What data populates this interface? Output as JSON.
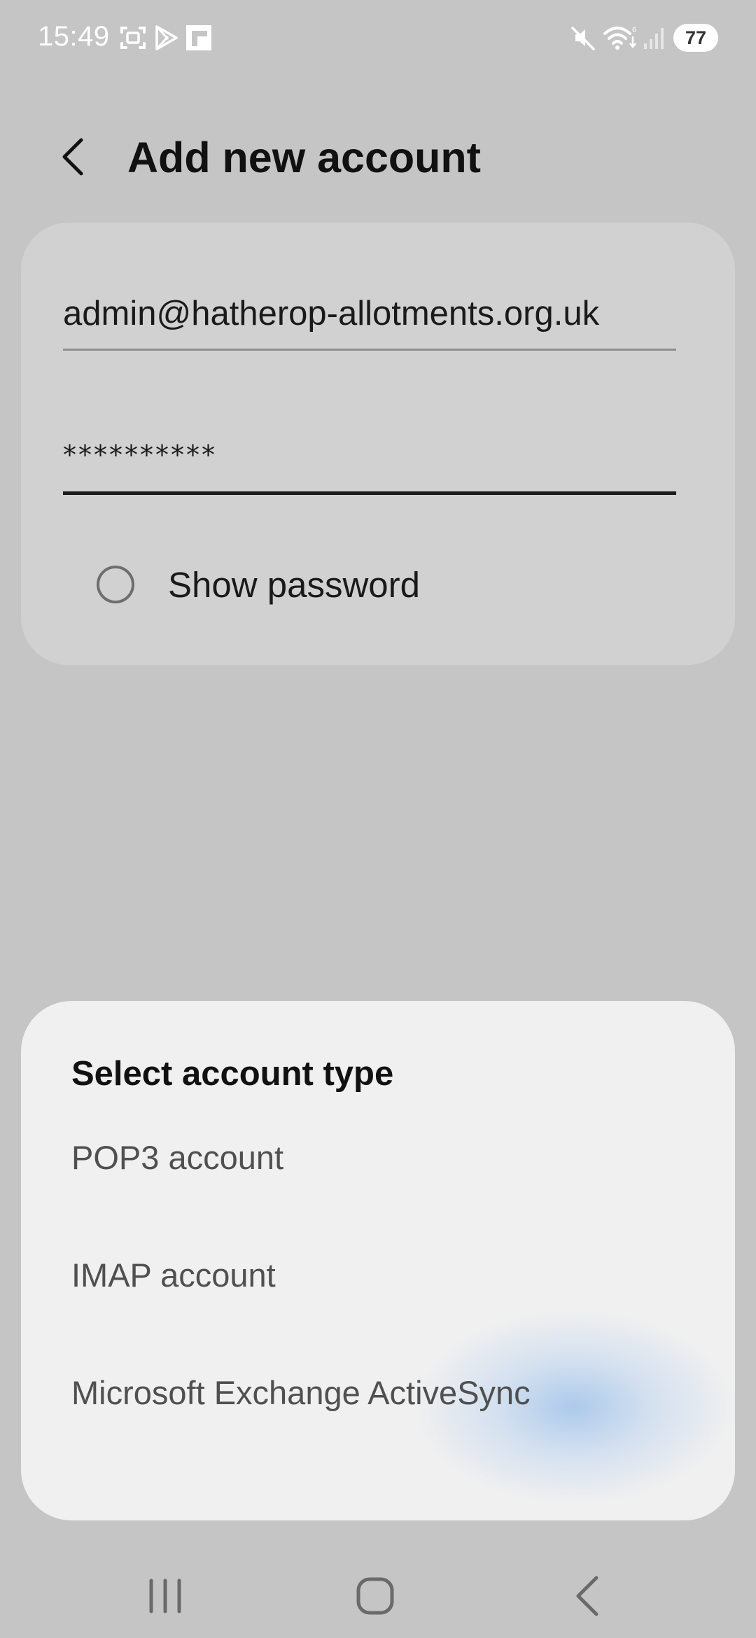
{
  "status_bar": {
    "time": "15:49",
    "battery": "77",
    "left_icons": [
      "screenshot-icon",
      "play-store-icon",
      "flipboard-icon"
    ],
    "right_icons": [
      "mute-icon",
      "wifi-icon",
      "signal-icon"
    ]
  },
  "header": {
    "title": "Add new account",
    "back_icon": "chevron-left-icon"
  },
  "form": {
    "email": "admin@hatherop-allotments.org.uk",
    "password_masked": "**********",
    "show_password_label": "Show password",
    "show_password_checked": false
  },
  "sheet": {
    "title": "Select account type",
    "options": [
      {
        "label": "POP3 account"
      },
      {
        "label": "IMAP account"
      },
      {
        "label": "Microsoft Exchange ActiveSync"
      }
    ]
  },
  "nav": {
    "recents": "recents-icon",
    "home": "home-icon",
    "back": "back-icon"
  },
  "colors": {
    "background": "#c5c5c5",
    "card": "#d1d1d1",
    "sheet": "#f0f0f0",
    "option_text": "#505050"
  }
}
